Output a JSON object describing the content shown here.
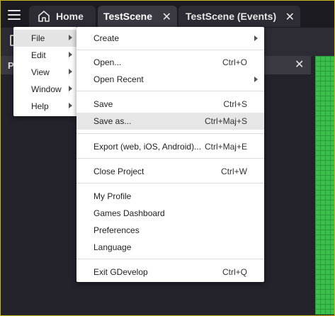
{
  "tabs": {
    "home": "Home",
    "scene": "TestScene",
    "events": "TestScene (Events)",
    "close_glyph": "✕"
  },
  "panel": {
    "title": "P",
    "close_glyph": "✕"
  },
  "main_menu": {
    "items": [
      "File",
      "Edit",
      "View",
      "Window",
      "Help"
    ]
  },
  "file_menu": {
    "create": "Create",
    "open": "Open...",
    "open_shortcut": "Ctrl+O",
    "open_recent": "Open Recent",
    "save": "Save",
    "save_shortcut": "Ctrl+S",
    "save_as": "Save as...",
    "save_as_shortcut": "Ctrl+Maj+S",
    "export": "Export (web, iOS, Android)...",
    "export_shortcut": "Ctrl+Maj+E",
    "close_project": "Close Project",
    "close_project_shortcut": "Ctrl+W",
    "my_profile": "My Profile",
    "games_dashboard": "Games Dashboard",
    "preferences": "Preferences",
    "language": "Language",
    "exit": "Exit GDevelop",
    "exit_shortcut": "Ctrl+Q"
  },
  "colors": {
    "accent_border": "#c9b81b",
    "canvas_green": "#3cbf4a",
    "bg": "#24222a"
  }
}
